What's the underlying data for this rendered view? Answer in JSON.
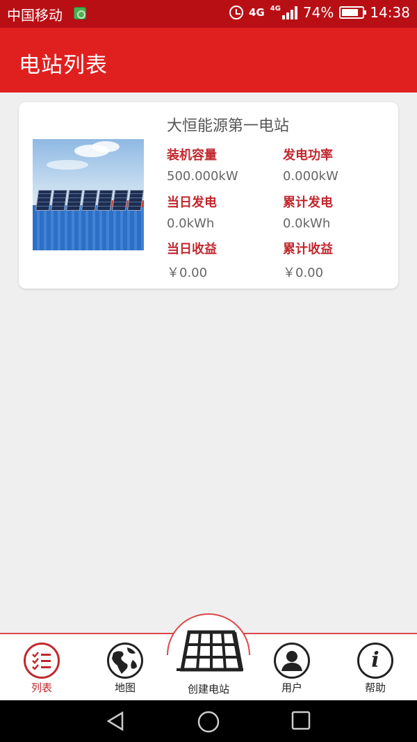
{
  "status_bar": {
    "carrier": "中国移动",
    "network": "4G",
    "network_small": "4G",
    "battery": "74%",
    "time": "14:38"
  },
  "header": {
    "title": "电站列表"
  },
  "station": {
    "name": "大恒能源第一电站",
    "installed_capacity_label": "装机容量",
    "installed_capacity_value": "500.000kW",
    "power_label": "发电功率",
    "power_value": "0.000kW",
    "daily_gen_label": "当日发电",
    "daily_gen_value": "0.0kWh",
    "total_gen_label": "累计发电",
    "total_gen_value": "0.0kWh",
    "daily_income_label": "当日收益",
    "daily_income_value": "￥0.00",
    "total_income_label": "累计收益",
    "total_income_value": "￥0.00"
  },
  "bottom_nav": {
    "list": "列表",
    "map": "地图",
    "create": "创建电站",
    "user": "用户",
    "help": "帮助"
  },
  "colors": {
    "status_bar": "#b80f15",
    "header": "#e0201f",
    "accent": "#c1272d",
    "background": "#efefef"
  },
  "icons": {
    "list": "list-icon",
    "map": "globe-icon",
    "create": "solar-panel-icon",
    "user": "user-icon",
    "help": "info-icon"
  }
}
